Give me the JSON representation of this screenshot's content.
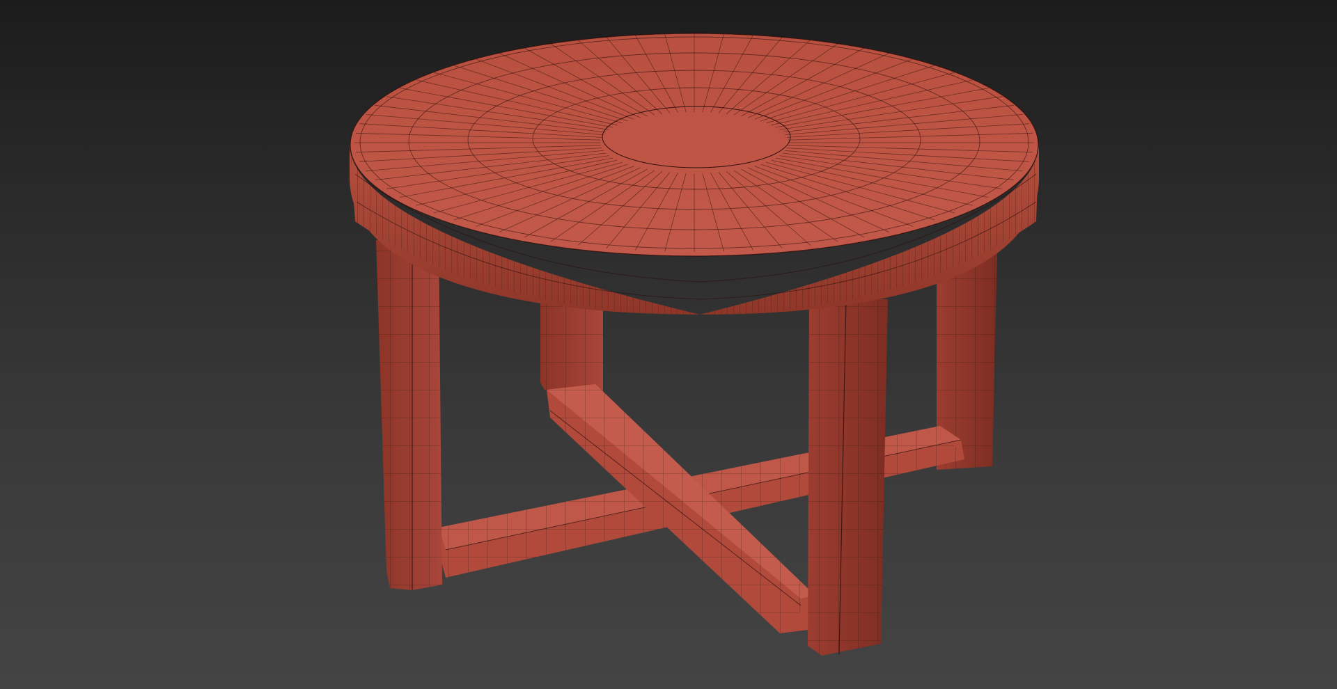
{
  "viewport": {
    "background_top": "#1c1c1c",
    "background_bottom": "#444444"
  },
  "model": {
    "object": "round-table",
    "display_mode": "shaded-with-wireframe",
    "material_color": "#b84f40",
    "material_color_dark": "#8a3326",
    "wire_color": "#2a0e0a"
  }
}
